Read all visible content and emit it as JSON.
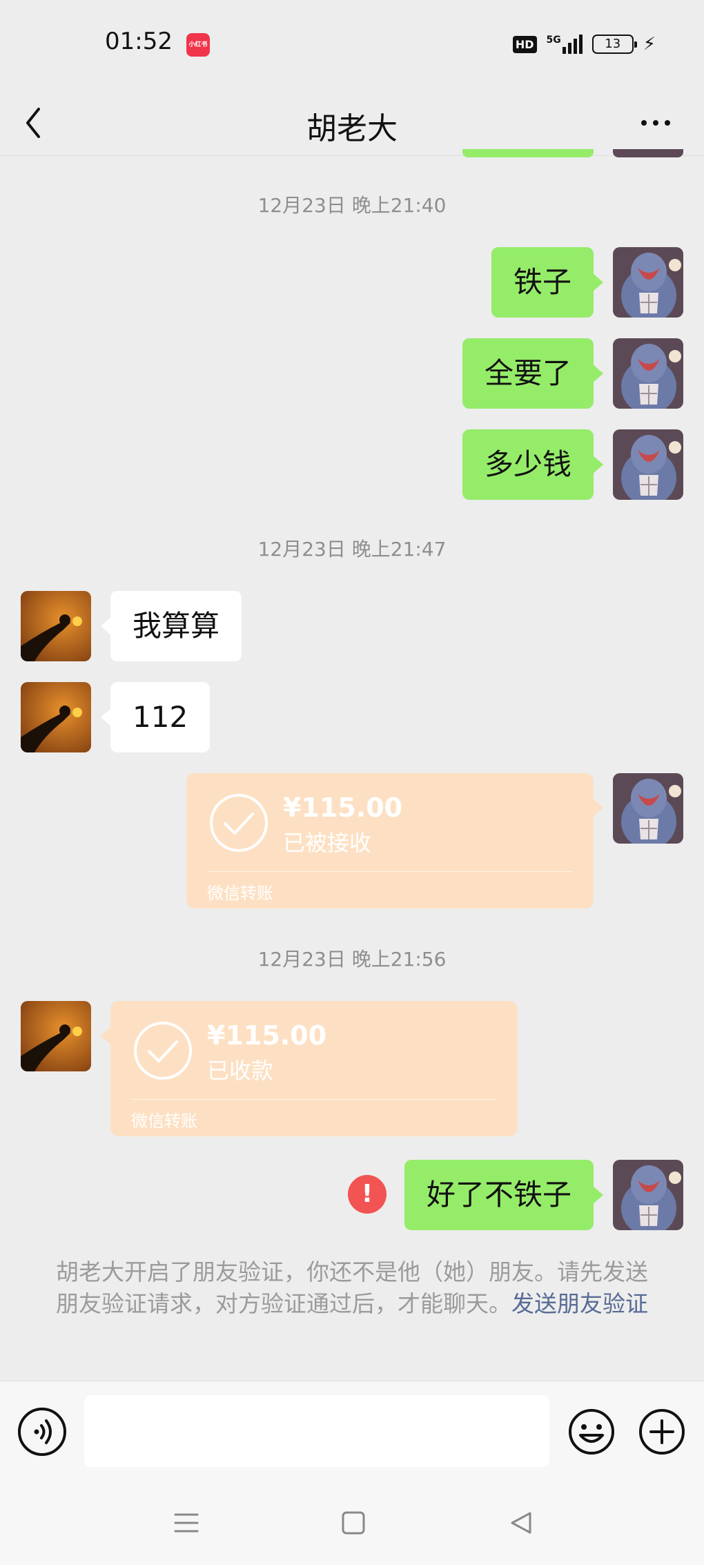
{
  "status_bar": {
    "time": "01:52",
    "app_badge": "小红书",
    "hd": "HD",
    "network": "5G",
    "battery": "13",
    "icons": [
      "hd-icon",
      "signal-icon",
      "battery-icon",
      "charging-icon"
    ]
  },
  "nav": {
    "title": "胡老大",
    "back_icon": "chevron-left-icon",
    "more_icon": "more-icon"
  },
  "messages": {
    "ts1": "12月23日 晚上21:40",
    "m1": "铁子",
    "m2": "全要了",
    "m3": "多少钱",
    "ts2": "12月23日 晚上21:47",
    "m4": "我算算",
    "m5": "112",
    "transfer1": {
      "amount": "¥115.00",
      "status": "已被接收",
      "label": "微信转账"
    },
    "ts3": "12月23日 晚上21:56",
    "transfer2": {
      "amount": "¥115.00",
      "status": "已收款",
      "label": "微信转账"
    },
    "m6": "好了不铁子",
    "error_mark": "!"
  },
  "notice": {
    "text": "胡老大开启了朋友验证，你还不是他（她）朋友。请先发送朋友验证请求，对方验证通过后，才能聊天。",
    "link": "发送朋友验证"
  },
  "input_bar": {
    "value": "",
    "icons": [
      "voice-icon",
      "emoji-icon",
      "plus-icon"
    ]
  },
  "system_nav": {
    "icons": [
      "menu-icon",
      "home-icon",
      "back-triangle-icon"
    ]
  },
  "colors": {
    "background": "#ededed",
    "sent_bubble": "#95ec69",
    "received_bubble": "#ffffff",
    "transfer_card": "#fde0c3",
    "error": "#f25353",
    "link": "#576b95"
  }
}
